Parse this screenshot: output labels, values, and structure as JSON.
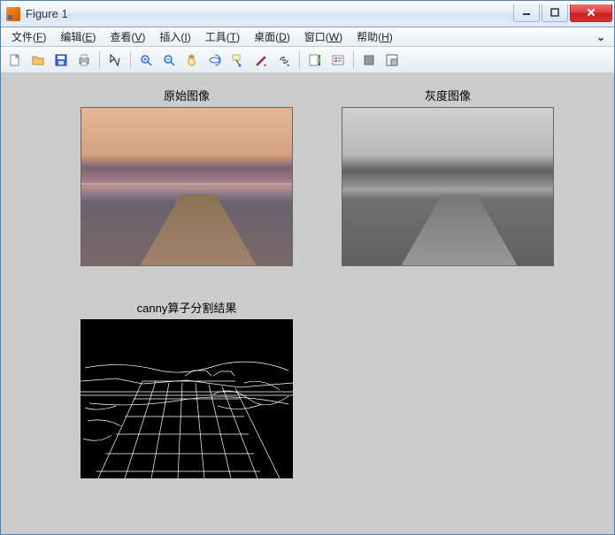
{
  "window": {
    "title": "Figure 1",
    "controls": {
      "min": "minimize",
      "max": "maximize",
      "close": "close"
    }
  },
  "menubar": {
    "items": [
      {
        "label": "文件(F)",
        "key": "F"
      },
      {
        "label": "编辑(E)",
        "key": "E"
      },
      {
        "label": "查看(V)",
        "key": "V"
      },
      {
        "label": "插入(I)",
        "key": "I"
      },
      {
        "label": "工具(T)",
        "key": "T"
      },
      {
        "label": "桌面(D)",
        "key": "D"
      },
      {
        "label": "窗口(W)",
        "key": "W"
      },
      {
        "label": "帮助(H)",
        "key": "H"
      }
    ],
    "dock_hint": "⌄"
  },
  "toolbar": {
    "groups": [
      [
        "new-figure",
        "open",
        "save",
        "print"
      ],
      [
        "edit-plot"
      ],
      [
        "zoom-in",
        "zoom-out",
        "pan",
        "rotate-3d",
        "data-cursor",
        "brush",
        "link"
      ],
      [
        "insert-colorbar",
        "insert-legend"
      ],
      [
        "hide-tools",
        "dock-figure"
      ]
    ],
    "names": {
      "new-figure": "New Figure",
      "open": "Open",
      "save": "Save",
      "print": "Print",
      "edit-plot": "Edit Plot",
      "zoom-in": "Zoom In",
      "zoom-out": "Zoom Out",
      "pan": "Pan",
      "rotate-3d": "Rotate 3D",
      "data-cursor": "Data Cursor",
      "brush": "Brush",
      "link": "Link Plot",
      "insert-colorbar": "Insert Colorbar",
      "insert-legend": "Insert Legend",
      "hide-tools": "Hide Plot Tools",
      "dock-figure": "Dock Figure"
    }
  },
  "subplots": [
    {
      "position": 1,
      "title": "原始图像",
      "content": "color-lake-dock-photo"
    },
    {
      "position": 2,
      "title": "灰度图像",
      "content": "grayscale-lake-dock-photo"
    },
    {
      "position": 3,
      "title": "canny算子分割结果",
      "content": "canny-edge-map"
    }
  ],
  "icons": {
    "minimize": "—",
    "maximize": "▢",
    "close": "✕"
  }
}
